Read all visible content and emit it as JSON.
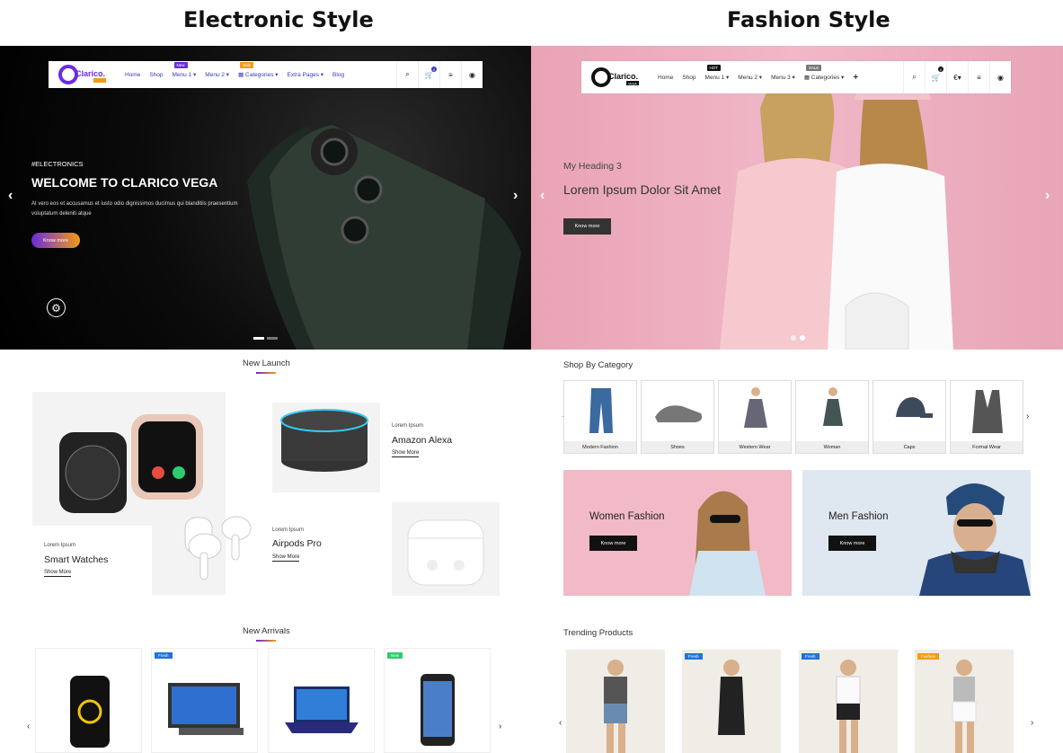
{
  "headings": {
    "left": "Electronic Style",
    "right": "Fashion Style"
  },
  "electronic": {
    "nav": {
      "items": [
        "Home",
        "Shop",
        "Menu 1",
        "Menu 2",
        "Categories",
        "Extra Pages",
        "Blog"
      ],
      "tags": {
        "menu1": "New",
        "categories": "Sale"
      },
      "cart_count": "0"
    },
    "hero": {
      "kicker": "#ELECTRONICS",
      "title": "WELCOME TO CLARICO VEGA",
      "text": "At vero eos et accusamus et iusto odio dignissimos ducimus qui blanditiis praesentium voluptatum deleniti atque",
      "button": "Know more"
    },
    "new_launch": {
      "title": "New Launch",
      "items": [
        {
          "kicker": "Lorem Ipsum",
          "title": "Smart Watches",
          "link": "Show More"
        },
        {
          "kicker": "Lorem Ipsum",
          "title": "Amazon Alexa",
          "link": "Show More"
        },
        {
          "kicker": "Lorem Ipsum",
          "title": "Airpods Pro",
          "link": "Show More"
        }
      ]
    },
    "new_arrivals": {
      "title": "New Arrivals",
      "badges": [
        "Fresh",
        "New"
      ]
    }
  },
  "fashion": {
    "logo_text": "Clarico.",
    "logo_sub": "VEGA",
    "nav": {
      "items": [
        "Home",
        "Shop",
        "Menu 1",
        "Menu 2",
        "Menu 3",
        "Categories"
      ],
      "tags": {
        "menu1": "HOT",
        "categories": "SALE"
      },
      "cart_count": "0",
      "currency": "€"
    },
    "hero": {
      "kicker": "My Heading 3",
      "title": "Lorem Ipsum Dolor Sit Amet",
      "button": "Know more"
    },
    "shop_by_category": {
      "title": "Shop By Category",
      "items": [
        "Modern Fashion",
        "Shoes",
        "Western Wear",
        "Woman",
        "Caps",
        "Formal Wear"
      ]
    },
    "banners": [
      {
        "title": "Women Fashion",
        "button": "Know more"
      },
      {
        "title": "Men Fashion",
        "button": "Know more"
      }
    ],
    "trending": {
      "title": "Trending Products",
      "badges": [
        "Fresh",
        "Fresh",
        "Fashion"
      ]
    }
  },
  "colors": {
    "accent": "#3a3ac0",
    "orange": "#f39c12",
    "purple": "#6a2be0",
    "pink": "#e9a3b5",
    "blue_badge": "#1e73d8",
    "green_badge": "#2ecc71"
  }
}
